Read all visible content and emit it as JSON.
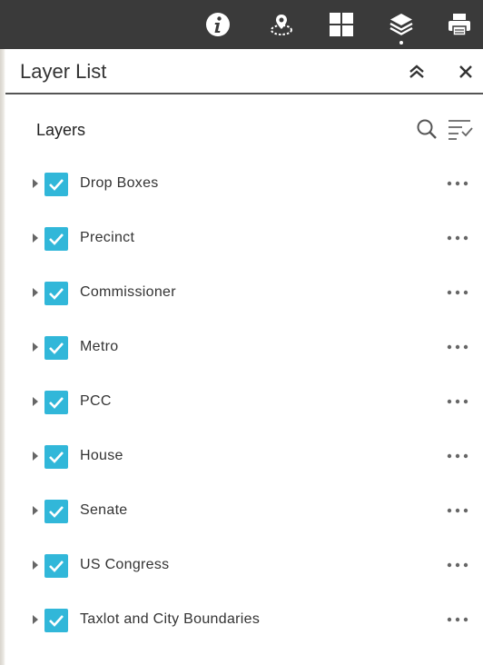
{
  "colors": {
    "toolbar_bg": "#3a3a3a",
    "checkbox": "#31b7d9",
    "text": "#333333"
  },
  "toolbar": {
    "tools": [
      {
        "icon": "info-icon"
      },
      {
        "icon": "location-icon"
      },
      {
        "icon": "grid-icon"
      },
      {
        "icon": "layers-icon",
        "active": true
      },
      {
        "icon": "print-icon"
      }
    ]
  },
  "panel": {
    "title": "Layer List",
    "collapse_icon": "double-chevron-up-icon",
    "close_icon": "close-icon"
  },
  "layers_section": {
    "title": "Layers",
    "search_icon": "search-icon",
    "filter_icon": "filter-list-icon"
  },
  "layers": [
    {
      "label": "Drop Boxes",
      "checked": true
    },
    {
      "label": "Precinct",
      "checked": true
    },
    {
      "label": "Commissioner",
      "checked": true
    },
    {
      "label": "Metro",
      "checked": true
    },
    {
      "label": "PCC",
      "checked": true
    },
    {
      "label": "House",
      "checked": true
    },
    {
      "label": "Senate",
      "checked": true
    },
    {
      "label": "US Congress",
      "checked": true
    },
    {
      "label": "Taxlot and City Boundaries",
      "checked": true
    }
  ]
}
